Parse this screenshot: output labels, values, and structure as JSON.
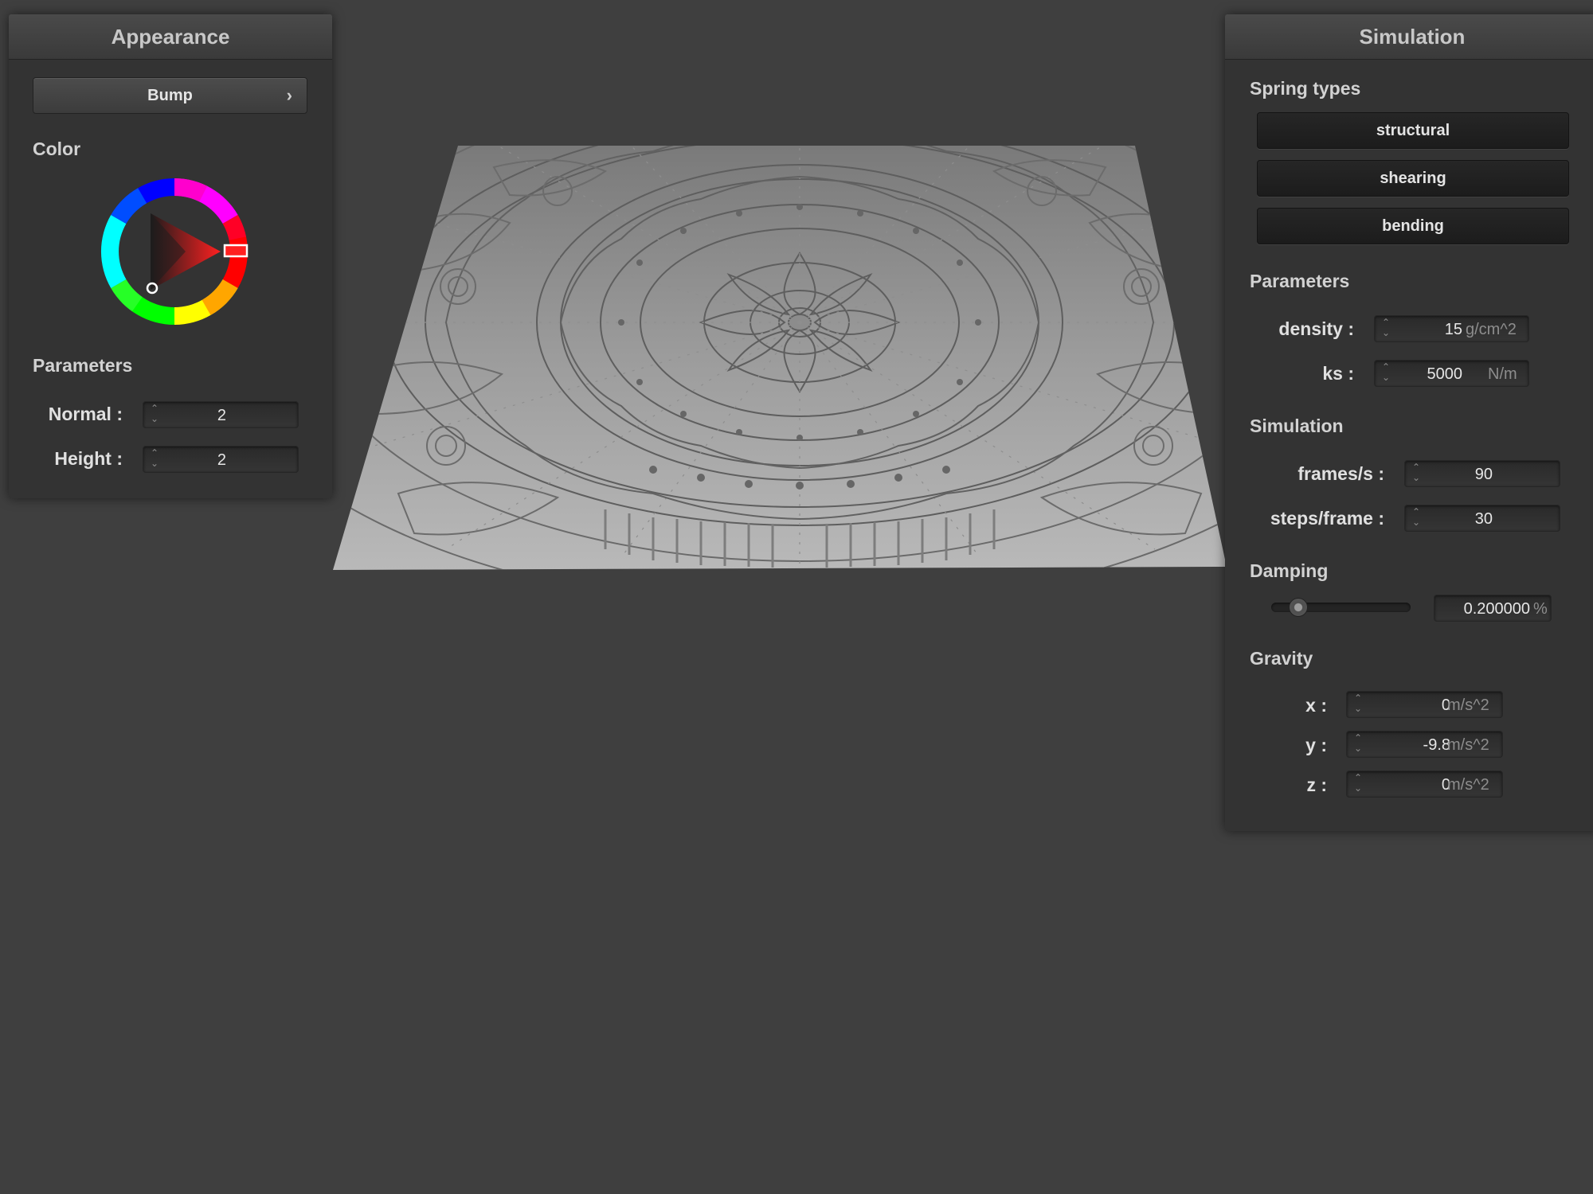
{
  "appearance": {
    "title": "Appearance",
    "shader_dropdown": {
      "selected": "Bump",
      "chevron": "chevron-right-icon"
    },
    "color_label": "Color",
    "color_wheel": {
      "selected_hue_hex": "#ff0000",
      "selected_color_hex": "#1a1a1a"
    },
    "parameters_label": "Parameters",
    "normal": {
      "label": "Normal :",
      "value": "2"
    },
    "height": {
      "label": "Height :",
      "value": "2"
    }
  },
  "simulation": {
    "title": "Simulation",
    "spring_types_label": "Spring types",
    "spring_buttons": {
      "structural": "structural",
      "shearing": "shearing",
      "bending": "bending"
    },
    "parameters_label": "Parameters",
    "density": {
      "label": "density :",
      "value": "15",
      "unit": "g/cm^2"
    },
    "ks": {
      "label": "ks :",
      "value": "5000",
      "unit": "N/m"
    },
    "simulation_label": "Simulation",
    "frames_per_s": {
      "label": "frames/s :",
      "value": "90"
    },
    "steps_per_frame": {
      "label": "steps/frame :",
      "value": "30"
    },
    "damping_label": "Damping",
    "damping": {
      "value": "0.200000",
      "unit": "%",
      "slider_fraction": 0.2
    },
    "gravity_label": "Gravity",
    "gravity_x": {
      "label": "x :",
      "value": "0",
      "unit": "m/s^2"
    },
    "gravity_y": {
      "label": "y :",
      "value": "-9.8",
      "unit": "m/s^2"
    },
    "gravity_z": {
      "label": "z :",
      "value": "0",
      "unit": "m/s^2"
    }
  },
  "colors": {
    "background": "#3f3f3f",
    "panel": "#333333",
    "cloth": "#9a9a9a"
  }
}
